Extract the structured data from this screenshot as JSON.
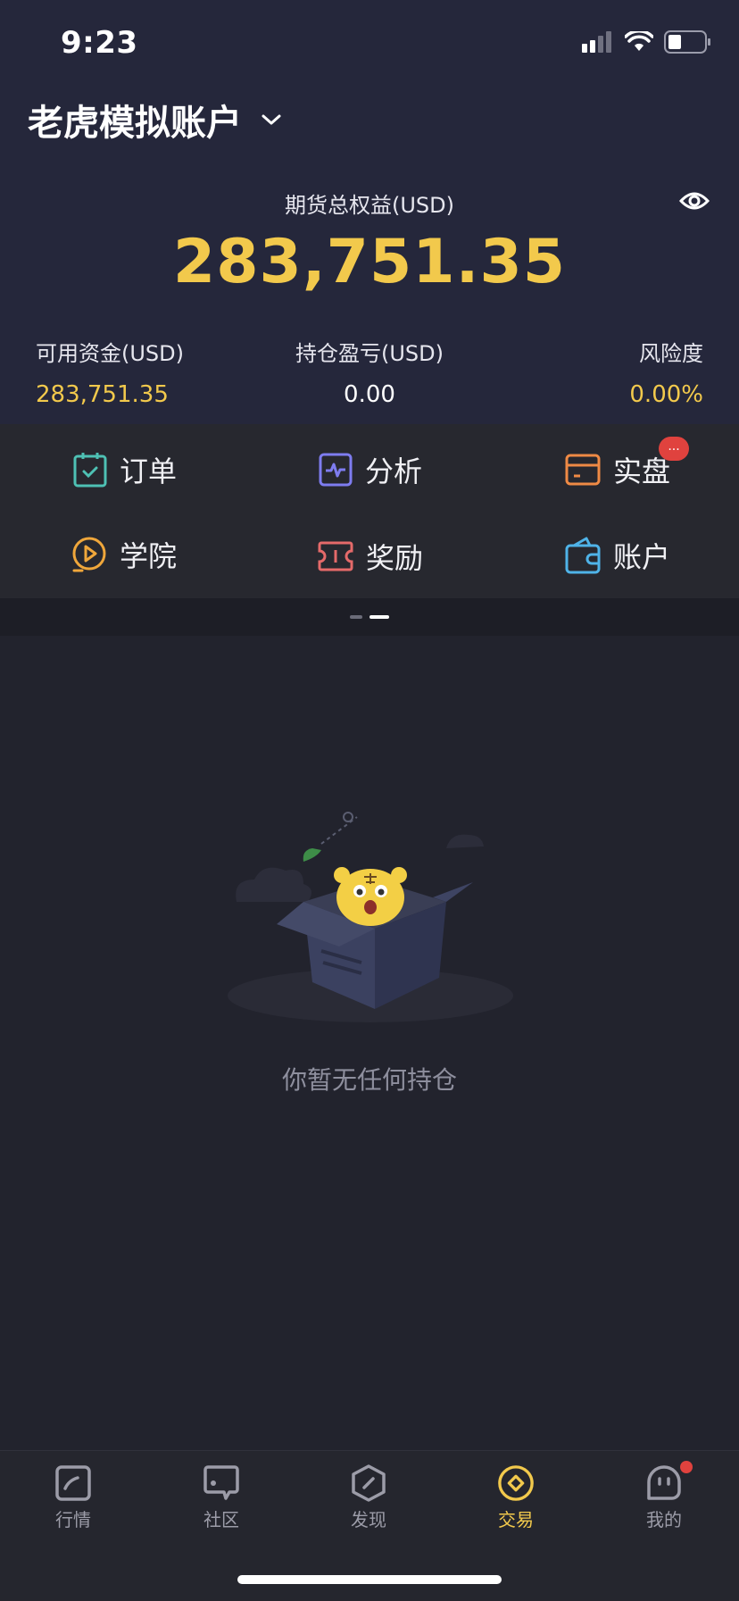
{
  "status_bar": {
    "time": "9:23"
  },
  "header": {
    "account_title": "老虎模拟账户"
  },
  "summary": {
    "equity_label": "期货总权益(USD)",
    "equity_value": "283,751.35",
    "available_label": "可用资金(USD)",
    "available_value": "283,751.35",
    "pnl_label": "持仓盈亏(USD)",
    "pnl_value": "0.00",
    "risk_label": "风险度",
    "risk_value": "0.00%"
  },
  "grid": {
    "items": [
      {
        "label": "订单",
        "icon": "calendar-check-icon"
      },
      {
        "label": "分析",
        "icon": "analysis-icon"
      },
      {
        "label": "实盘",
        "icon": "card-icon",
        "badge": "..."
      },
      {
        "label": "学院",
        "icon": "play-circle-icon"
      },
      {
        "label": "奖励",
        "icon": "ticket-icon"
      },
      {
        "label": "账户",
        "icon": "wallet-icon"
      }
    ]
  },
  "empty_state": {
    "message": "你暂无任何持仓"
  },
  "tabbar": {
    "items": [
      {
        "label": "行情",
        "icon": "chart-icon"
      },
      {
        "label": "社区",
        "icon": "community-icon"
      },
      {
        "label": "发现",
        "icon": "discover-icon"
      },
      {
        "label": "交易",
        "icon": "trade-icon",
        "active": true
      },
      {
        "label": "我的",
        "icon": "profile-icon"
      }
    ]
  },
  "colors": {
    "accent": "#f2c94c",
    "badge": "#e0423e",
    "header_bg": "#25273b",
    "page_bg": "#22232d"
  }
}
